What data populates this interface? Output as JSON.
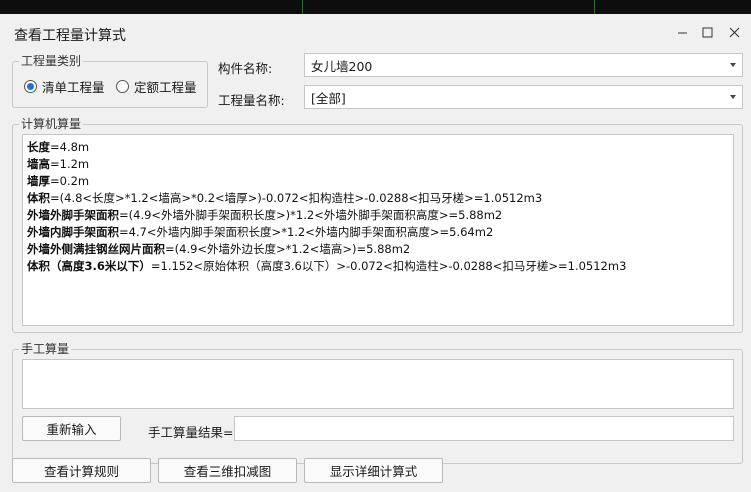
{
  "window": {
    "title": "查看工程量计算式"
  },
  "category": {
    "legend": "工程量类别",
    "options": [
      {
        "label": "清单工程量",
        "selected": true
      },
      {
        "label": "定额工程量",
        "selected": false
      }
    ]
  },
  "component": {
    "label": "构件名称:",
    "value": "女儿墙200"
  },
  "quantity_name": {
    "label": "工程量名称:",
    "value": "[全部]"
  },
  "computer_calc": {
    "legend": "计算机算量",
    "lines": [
      {
        "name": "长度",
        "expr": "=4.8m"
      },
      {
        "name": "墙高",
        "expr": "=1.2m"
      },
      {
        "name": "墙厚",
        "expr": "=0.2m"
      },
      {
        "name": "体积",
        "expr": "=(4.8<长度>*1.2<墙高>*0.2<墙厚>)-0.072<扣构造柱>-0.0288<扣马牙槎>=1.0512m3"
      },
      {
        "name": "外墙外脚手架面积",
        "expr": "=(4.9<外墙外脚手架面积长度>)*1.2<外墙外脚手架面积高度>=5.88m2"
      },
      {
        "name": "外墙内脚手架面积",
        "expr": "=4.7<外墙内脚手架面积长度>*1.2<外墙内脚手架面积高度>=5.64m2"
      },
      {
        "name": "外墙外侧满挂钢丝网片面积",
        "expr": "=(4.9<外墙外边长度>*1.2<墙高>)=5.88m2"
      },
      {
        "name": "体积（高度3.6米以下）",
        "expr": "=1.152<原始体积（高度3.6以下）>-0.072<扣构造柱>-0.0288<扣马牙槎>=1.0512m3"
      }
    ]
  },
  "manual_calc": {
    "legend": "手工算量",
    "reenter_label": "重新输入",
    "result_label": "手工算量结果="
  },
  "footer": {
    "rules_label": "查看计算规则",
    "view3d_label": "查看三维扣减图",
    "detail_label": "显示详细计算式"
  }
}
